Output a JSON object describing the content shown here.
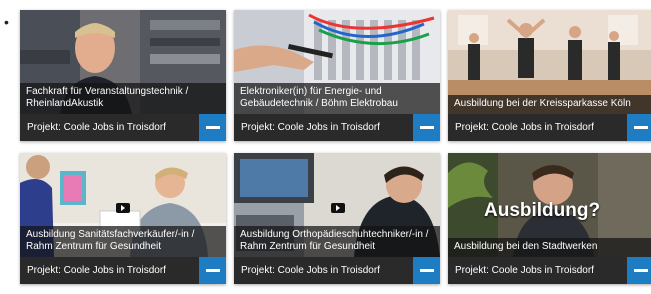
{
  "colors": {
    "accent": "#1e7cc3",
    "footer_bg": "#2a2a2a"
  },
  "bullet": "•",
  "cards": [
    {
      "title": "Fachkraft für Veranstaltungstechnik / RheinlandAkustik",
      "project": "Projekt: Coole Jobs in Troisdorf",
      "button_icon": "collapse-minus-icon"
    },
    {
      "title": "Elektroniker(in) für Energie- und Gebäudetechnik / Böhm Elektrobau",
      "project": "Projekt: Coole Jobs in Troisdorf",
      "button_icon": "collapse-minus-icon"
    },
    {
      "title": "Ausbildung bei der Kreissparkasse Köln",
      "project": "Projekt: Coole Jobs in Troisdorf",
      "button_icon": "collapse-minus-icon"
    },
    {
      "title": "Ausbildung Sanitätsfachverkäufer/-in / Rahm Zentrum für Gesundheit",
      "project": "Projekt: Coole Jobs in Troisdorf",
      "button_icon": "collapse-minus-icon"
    },
    {
      "title": "Ausbildung Orthopädieschuhtechniker/-in / Rahm Zentrum für Gesundheit",
      "project": "Projekt: Coole Jobs in Troisdorf",
      "button_icon": "collapse-minus-icon"
    },
    {
      "title": "Ausbildung bei den Stadtwerken",
      "project": "Projekt: Coole Jobs in Troisdorf",
      "button_icon": "collapse-minus-icon",
      "overlay_text": "Ausbildung?"
    }
  ]
}
